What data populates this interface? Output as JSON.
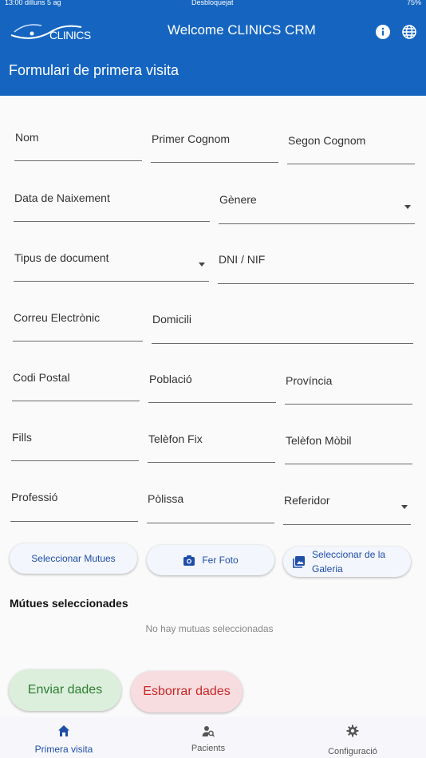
{
  "status_bar": {
    "time_date": "13:00 dilluns 5 ag",
    "lock_status": "Desbloquejat",
    "battery": "75%"
  },
  "app_bar": {
    "logo_text": "CLINICS",
    "title": "Welcome CLINICS CRM",
    "page_title": "Formulari de primera visita"
  },
  "form": {
    "nom": "Nom",
    "primer_cognom": "Primer Cognom",
    "segon_cognom": "Segon Cognom",
    "data_naixement": "Data de Naixement",
    "genere": "Gènere",
    "tipus_document": "Tipus de document",
    "dni": "DNI / NIF",
    "correu": "Correu Electrònic",
    "domicili": "Domicili",
    "codi_postal": "Codi Postal",
    "poblacio": "Població",
    "provincia": "Província",
    "fills": "Fills",
    "telefon_fix": "Telèfon Fix",
    "telefon_mobil": "Telèfon Mòbil",
    "professio": "Professió",
    "polissa": "Pòlissa",
    "referidor": "Referidor"
  },
  "actions": {
    "seleccionar_mutues": "Seleccionar Mutues",
    "fer_foto": "Fer Foto",
    "seleccionar_galeria_1": "Seleccionar de la",
    "seleccionar_galeria_2": "Galeria"
  },
  "mutues": {
    "heading": "Mútues seleccionades",
    "empty": "No hay mutuas seleccionadas"
  },
  "buttons": {
    "enviar": "Enviar dades",
    "esborrar": "Esborrar dades"
  },
  "bottom_nav": {
    "primera_visita": "Primera visita",
    "pacients": "Pacients",
    "configuracio": "Configuració"
  },
  "colors": {
    "primary": "#1565c0",
    "accent_text": "#1f4ea8",
    "send_bg": "#dcefdc",
    "delete_bg": "#f8dde0"
  }
}
